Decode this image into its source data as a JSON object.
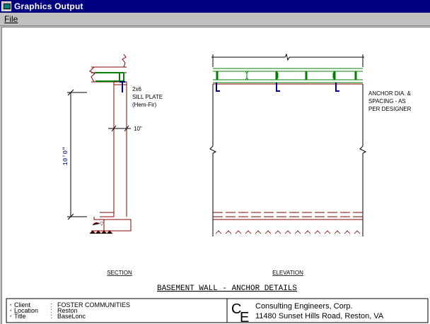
{
  "window": {
    "title": "Graphics Output"
  },
  "menu": {
    "file": "File"
  },
  "section": {
    "sill_size": "2x6",
    "sill_label": "SILL PLATE",
    "sill_species": "(Hem-Fir)",
    "thickness": "10\"",
    "height": "10'0\"",
    "caption": "SECTION"
  },
  "elevation": {
    "note_line1": "ANCHOR DIA. &",
    "note_line2": "SPACING - AS",
    "note_line3": "PER DESIGNER",
    "caption": "ELEVATION"
  },
  "drawing_title": "BASEMENT WALL - ANCHOR DETAILS",
  "title_block": {
    "client_label": "Client",
    "location_label": "Location",
    "title_label": "Title",
    "client_value": "FOSTER COMMUNITIES",
    "location_value": "Reston",
    "title_value": "BaseLonc",
    "logo_c": "C",
    "logo_e": "E",
    "company": "Consulting Engineers, Corp.",
    "address": "11480 Sunset Hills Road, Reston, VA"
  },
  "colors": {
    "wall": "#800000",
    "joist": "#008000",
    "anchor": "#000080",
    "dimension": "#000080"
  }
}
